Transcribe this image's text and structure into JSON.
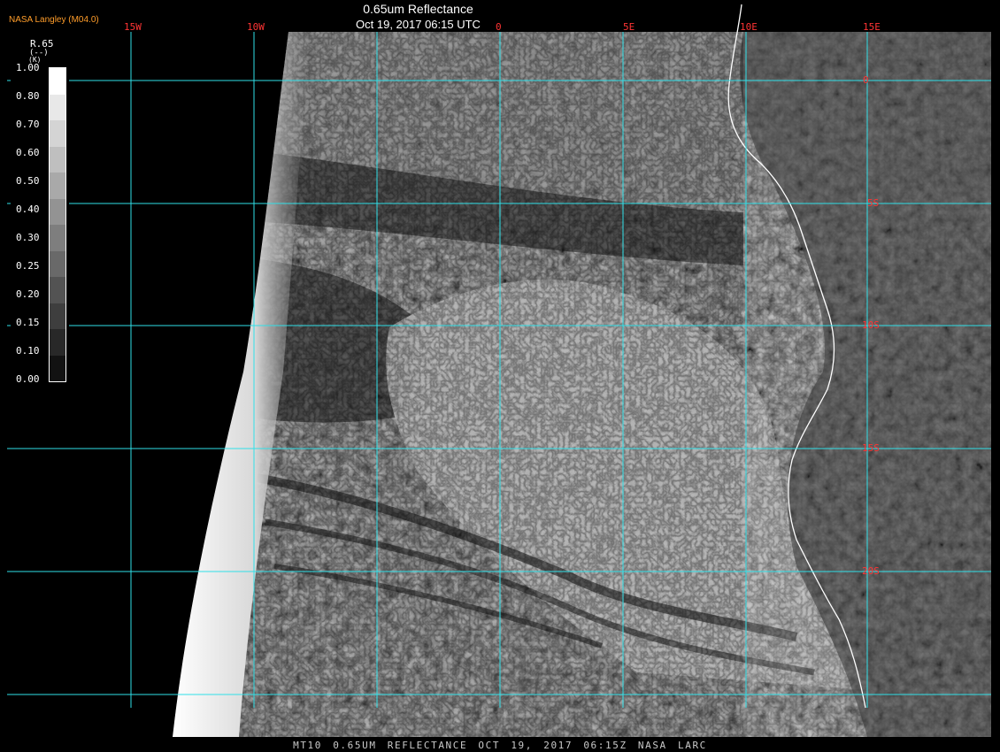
{
  "header": {
    "producer": "NASA Langley (M04.0)",
    "title": "0.65um Reflectance",
    "timestamp": "Oct 19, 2017 06:15 UTC"
  },
  "footer": {
    "caption": "MT10  0.65UM REFLECTANCE   OCT 19, 2017 06:15Z   NASA LARC"
  },
  "legend": {
    "title": "R.65",
    "units": "(--)",
    "unit_k": "(K)",
    "labels": [
      "1.00",
      "0.80",
      "0.70",
      "0.60",
      "0.50",
      "0.40",
      "0.30",
      "0.25",
      "0.20",
      "0.15",
      "0.10",
      "0.00"
    ],
    "colors": [
      "#ffffff",
      "#e8e8e8",
      "#d4d4d4",
      "#bfbfbf",
      "#a9a9a9",
      "#939393",
      "#7e7e7e",
      "#696969",
      "#535353",
      "#3e3e3e",
      "#282828",
      "#121212"
    ]
  },
  "grid": {
    "lon_labels": [
      "15W",
      "10W",
      "0",
      "5E",
      "10E",
      "15E"
    ],
    "lat_labels": [
      "0",
      "5S",
      "10S",
      "15S",
      "20S"
    ],
    "line_color": "#30e0e8",
    "label_color": "#ff3434"
  },
  "colors": {
    "background": "#000000",
    "coastline": "#ffffff"
  }
}
